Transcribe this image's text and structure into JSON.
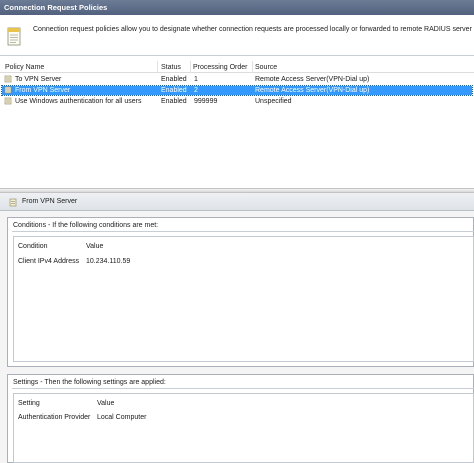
{
  "window": {
    "title": "Connection Request Policies"
  },
  "description": "Connection request policies allow you to designate whether connection requests are processed locally or forwarded to remote RADIUS server",
  "table": {
    "columns": [
      "Policy Name",
      "Status",
      "Processing Order",
      "Source"
    ],
    "rows": [
      {
        "name": "To VPN Server",
        "status": "Enabled",
        "order": "1",
        "source": "Remote Access Server(VPN-Dial up)",
        "selected": false
      },
      {
        "name": "From VPN Server",
        "status": "Enabled",
        "order": "2",
        "source": "Remote Access Server(VPN-Dial up)",
        "selected": true
      },
      {
        "name": "Use Windows authentication for all users",
        "status": "Enabled",
        "order": "999999",
        "source": "Unspecified",
        "selected": false
      }
    ]
  },
  "detail": {
    "title": "From VPN Server",
    "conditions": {
      "label": "Conditions - If the following conditions are met:",
      "columns": [
        "Condition",
        "Value"
      ],
      "rows": [
        {
          "key": "Client IPv4 Address",
          "value": "10.234.110.59"
        }
      ]
    },
    "settings": {
      "label": "Settings - Then the following settings are applied:",
      "columns": [
        "Setting",
        "Value"
      ],
      "rows": [
        {
          "key": "Authentication Provider",
          "value": "Local Computer"
        }
      ]
    }
  },
  "icons": {
    "description": "document-icon",
    "policy": "policy-scroll-icon"
  },
  "colors": {
    "titlebar": "#51617e",
    "selection": "#3399ff"
  }
}
